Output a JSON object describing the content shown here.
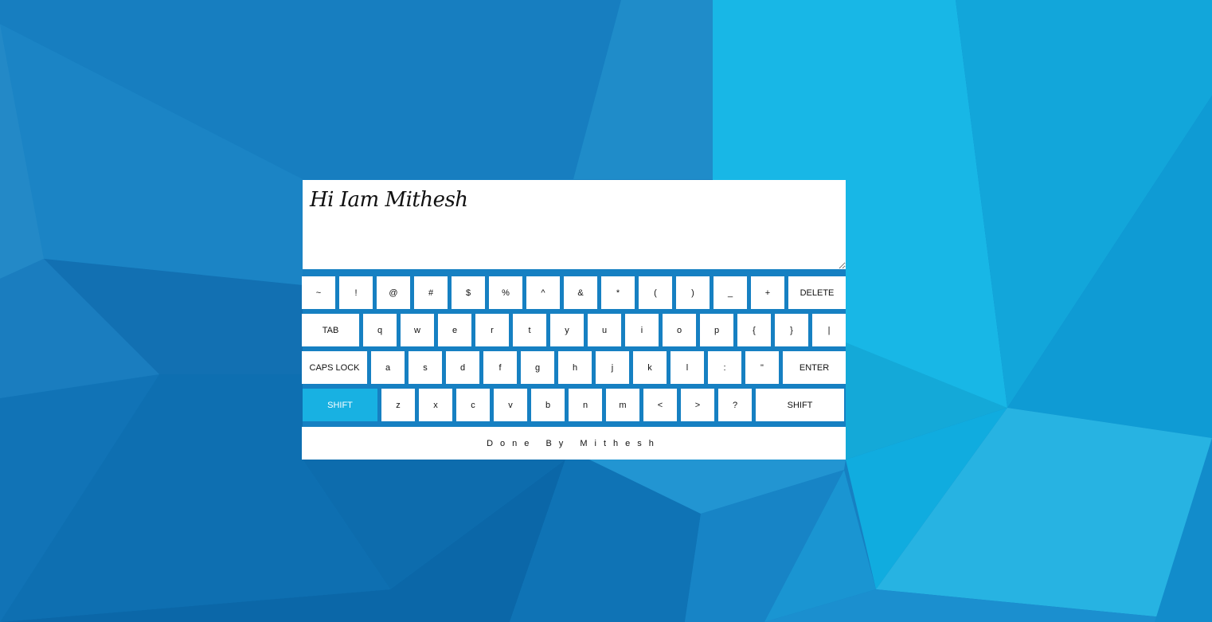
{
  "editor": {
    "text": "Hi Iam Mithesh"
  },
  "keyboard": {
    "rows": [
      [
        "~",
        "!",
        "@",
        "#",
        "$",
        "%",
        "^",
        "&",
        "*",
        "(",
        ")",
        "_",
        "+",
        "DELETE"
      ],
      [
        "TAB",
        "q",
        "w",
        "e",
        "r",
        "t",
        "y",
        "u",
        "i",
        "o",
        "p",
        "{",
        "}",
        "|"
      ],
      [
        "CAPS LOCK",
        "a",
        "s",
        "d",
        "f",
        "g",
        "h",
        "j",
        "k",
        "l",
        ":",
        "\"",
        "ENTER"
      ],
      [
        "SHIFT",
        "z",
        "x",
        "c",
        "v",
        "b",
        "n",
        "m",
        "<",
        ">",
        "?",
        "SHIFT"
      ]
    ],
    "active_key": "SHIFT (left)"
  },
  "footer": {
    "credit": "Done By Mithesh"
  },
  "colors": {
    "active_key": "#18b1e2",
    "key_background": "#ffffff",
    "background_dark": "#0a6fb4",
    "background_light": "#19b8e6"
  }
}
